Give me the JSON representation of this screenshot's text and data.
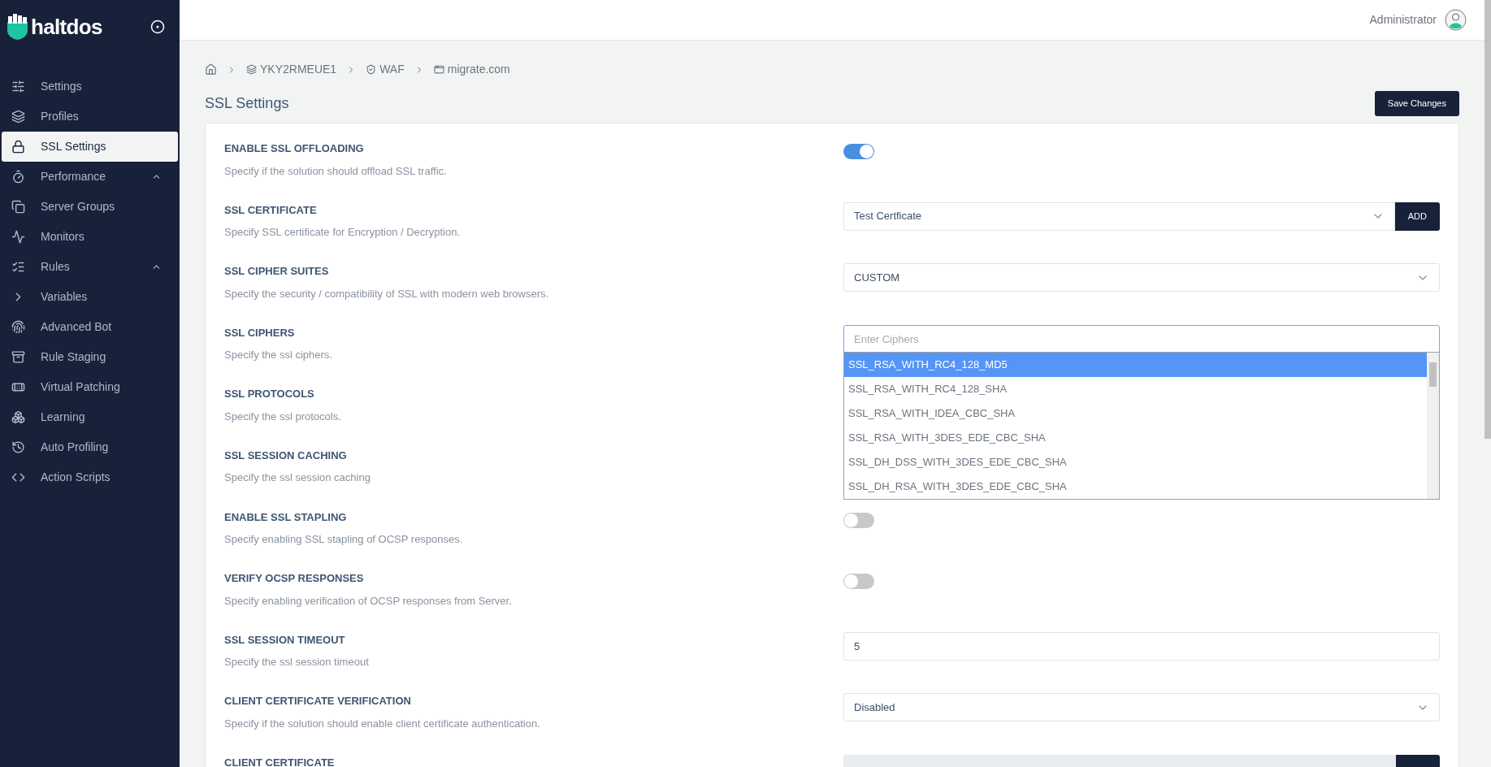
{
  "sidebar": {
    "brand": "haltdos",
    "items": [
      {
        "label": "Settings",
        "kind": "link",
        "selected": false
      },
      {
        "label": "Profiles",
        "kind": "link",
        "selected": false
      },
      {
        "label": "SSL Settings",
        "kind": "link",
        "selected": true
      },
      {
        "label": "Performance",
        "kind": "group",
        "selected": false,
        "expanded": true
      },
      {
        "label": "Server Groups",
        "kind": "link",
        "selected": false
      },
      {
        "label": "Monitors",
        "kind": "link",
        "selected": false
      },
      {
        "label": "Rules",
        "kind": "group",
        "selected": false,
        "expanded": true
      },
      {
        "label": "Variables",
        "kind": "link",
        "selected": false
      },
      {
        "label": "Advanced Bot",
        "kind": "link",
        "selected": false
      },
      {
        "label": "Rule Staging",
        "kind": "link",
        "selected": false
      },
      {
        "label": "Virtual Patching",
        "kind": "link",
        "selected": false
      },
      {
        "label": "Learning",
        "kind": "link",
        "selected": false
      },
      {
        "label": "Auto Profiling",
        "kind": "link",
        "selected": false
      },
      {
        "label": "Action Scripts",
        "kind": "link",
        "selected": false
      }
    ]
  },
  "header": {
    "user": "Administrator"
  },
  "breadcrumb": [
    "YKY2RMEUE1",
    "WAF",
    "migrate.com"
  ],
  "page": {
    "title": "SSL Settings",
    "save_button": "Save Changes"
  },
  "settings": [
    {
      "label": "ENABLE SSL OFFLOADING",
      "description": "Specify if the solution should offload SSL traffic.",
      "kind": "toggle",
      "on": true
    },
    {
      "label": "SSL CERTIFICATE",
      "description": "Specify SSL certificate for Encryption / Decryption.",
      "kind": "select_add",
      "value": "Test Certficate",
      "button": "ADD"
    },
    {
      "label": "SSL CIPHER SUITES",
      "description": "Specify the security / compatibility of SSL with modern web browsers.",
      "kind": "select",
      "value": "CUSTOM"
    },
    {
      "label": "SSL CIPHERS",
      "description": "Specify the ssl ciphers.",
      "kind": "multiselect",
      "placeholder": "Enter Ciphers",
      "options": [
        {
          "label": "SSL_RSA_WITH_RC4_128_MD5",
          "selected": true
        },
        {
          "label": "SSL_RSA_WITH_RC4_128_SHA",
          "selected": false
        },
        {
          "label": "SSL_RSA_WITH_IDEA_CBC_SHA",
          "selected": false
        },
        {
          "label": "SSL_RSA_WITH_3DES_EDE_CBC_SHA",
          "selected": false
        },
        {
          "label": "SSL_DH_DSS_WITH_3DES_EDE_CBC_SHA",
          "selected": false
        },
        {
          "label": "SSL_DH_RSA_WITH_3DES_EDE_CBC_SHA",
          "selected": false
        }
      ]
    },
    {
      "label": "SSL PROTOCOLS",
      "description": "Specify the ssl protocols.",
      "kind": "hidden"
    },
    {
      "label": "SSL SESSION CACHING",
      "description": "Specify the ssl session caching",
      "kind": "hidden"
    },
    {
      "label": "ENABLE SSL STAPLING",
      "description": "Specify enabling SSL stapling of OCSP responses.",
      "kind": "toggle",
      "on": false
    },
    {
      "label": "VERIFY OCSP RESPONSES",
      "description": "Specify enabling verification of OCSP responses from Server.",
      "kind": "toggle",
      "on": false
    },
    {
      "label": "SSL SESSION TIMEOUT",
      "description": "Specify the ssl session timeout",
      "kind": "input",
      "value": "5"
    },
    {
      "label": "CLIENT CERTIFICATE VERIFICATION",
      "description": "Specify if the solution should enable client certificate authentication.",
      "kind": "select",
      "value": "Disabled"
    },
    {
      "label": "CLIENT CERTIFICATE",
      "kind": "disabled_add"
    }
  ]
}
